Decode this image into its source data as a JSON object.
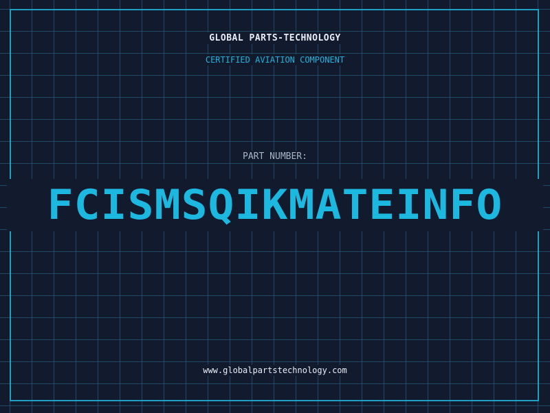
{
  "header": {
    "company": "GLOBAL PARTS-TECHNOLOGY",
    "subtitle": "CERTIFIED AVIATION COMPONENT"
  },
  "part": {
    "label": "PART NUMBER:",
    "number": "FCISMSQIKMATEINFO"
  },
  "footer": {
    "website": "www.globalpartstechnology.com"
  },
  "colors": {
    "background": "#121a2e",
    "grid": "#1f4a63",
    "frame": "#1f9fc4",
    "accent": "#1cb8e0",
    "text": "#e8edf5",
    "muted": "#a6b6c8"
  }
}
